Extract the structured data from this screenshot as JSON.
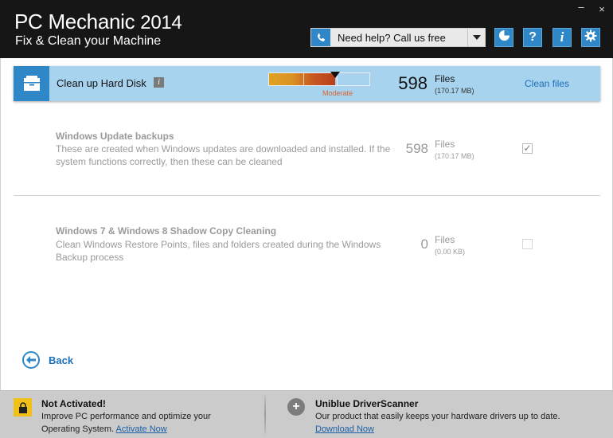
{
  "header": {
    "app_name": "PC Mechanic",
    "app_year": "2014",
    "subtitle": "Fix & Clean your Machine",
    "minimize_glyph": "–",
    "close_glyph": "×",
    "help_text": "Need help? Call us free",
    "icons": [
      "phone-icon",
      "chevron-down-icon",
      "clock-icon",
      "question-icon",
      "info-icon",
      "gear-icon"
    ],
    "question_glyph": "?",
    "info_glyph": "i"
  },
  "section": {
    "title": "Clean up Hard Disk",
    "info_glyph": "i",
    "meter_label": "Moderate",
    "meter_level_fraction": 0.66,
    "count": "598",
    "units": "Files",
    "size": "(170.17 MB)",
    "action": "Clean files"
  },
  "items": [
    {
      "title": "Windows Update backups",
      "desc": "These are created when Windows updates are downloaded and installed. If the system functions correctly, then these can be cleaned",
      "count": "598",
      "units": "Files",
      "size": "(170.17 MB)",
      "checked": true,
      "check_glyph": "✓"
    },
    {
      "title": "Windows 7 & Windows 8 Shadow Copy Cleaning",
      "desc": "Clean Windows Restore Points, files and folders created during the Windows Backup process",
      "count": "0",
      "units": "Files",
      "size": "(0.00 KB)",
      "checked": false
    }
  ],
  "back_label": "Back",
  "footer": {
    "left": {
      "title": "Not Activated!",
      "text": "Improve PC performance and optimize your Operating System.",
      "link": "Activate Now"
    },
    "right": {
      "title": "Uniblue DriverScanner",
      "text": "Our product that easily keeps your hardware drivers up to date.",
      "link": "Download Now"
    }
  },
  "colors": {
    "header_bg": "#161616",
    "accent_blue": "#2f87c7",
    "section_bg": "#a8d3ef",
    "link_blue": "#1b6fb8",
    "meter_label": "#d8652f",
    "lock_yellow": "#f2c017",
    "footer_bg": "#cbcbcb"
  }
}
